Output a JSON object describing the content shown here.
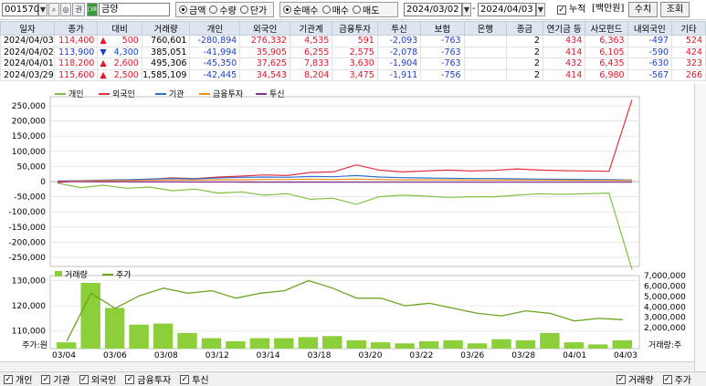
{
  "toolbar": {
    "code": "001570",
    "name": "금양",
    "amount_group": [
      "금액",
      "수량",
      "단가"
    ],
    "amount_selected": 0,
    "buy_group": [
      "순매수",
      "매수",
      "매도"
    ],
    "buy_selected": 0,
    "date_from": "2024/03/02",
    "date_to": "2024/04/03",
    "cumulative_label": "누적",
    "unit_label": "[백만원]",
    "btn_fix": "수치",
    "btn_query": "조회",
    "logo_text": "[38]"
  },
  "grid": {
    "headers": [
      "일자",
      "종가",
      "대비",
      "거래량",
      "개인",
      "외국인",
      "기관계",
      "금융투자",
      "투신",
      "보험",
      "은행",
      "종금",
      "연기금 등",
      "사모펀드",
      "내외국인",
      "기타"
    ],
    "rows": [
      [
        "2024/04/03",
        "114,400",
        "▲",
        "500",
        "760,601",
        "-280,894",
        "276,332",
        "4,535",
        "591",
        "-2,093",
        "-763",
        "",
        "2",
        "434",
        "6,363",
        "-497",
        "524"
      ],
      [
        "2024/04/02",
        "113,900",
        "▼",
        "4,300",
        "385,051",
        "-41,994",
        "35,905",
        "6,255",
        "2,575",
        "-2,078",
        "-763",
        "",
        "2",
        "414",
        "6,105",
        "-590",
        "424"
      ],
      [
        "2024/04/01",
        "118,200",
        "▲",
        "2,600",
        "495,306",
        "-45,350",
        "37,625",
        "7,833",
        "3,630",
        "-1,904",
        "-763",
        "",
        "2",
        "432",
        "6,435",
        "-630",
        "323"
      ],
      [
        "2024/03/29",
        "115,600",
        "▲",
        "2,500",
        "1,585,109",
        "-42,445",
        "34,543",
        "8,204",
        "3,475",
        "-1,911",
        "-756",
        "",
        "2",
        "414",
        "6,980",
        "-567",
        "266"
      ]
    ]
  },
  "chart_data": [
    {
      "type": "line",
      "legend": [
        "개인",
        "외국인",
        "기관",
        "금융투자",
        "투신"
      ],
      "colors": [
        "#7dc242",
        "#e1323f",
        "#2c6fcf",
        "#f18f1d",
        "#8a2f9c"
      ],
      "yticks": [
        "250,000",
        "200,000",
        "150,000",
        "100,000",
        "50,000",
        "0",
        "-50,000",
        "-100,000",
        "-150,000",
        "-200,000",
        "-250,000"
      ],
      "ylim": [
        -280000,
        280000
      ],
      "series": [
        {
          "name": "개인",
          "values": [
            -5000,
            -20000,
            -12000,
            -22000,
            -18000,
            -30000,
            -25000,
            -38000,
            -34000,
            -45000,
            -40000,
            -58000,
            -55000,
            -75000,
            -50000,
            -45000,
            -48000,
            -52000,
            -50000,
            -50000,
            -45000,
            -40000,
            -42000,
            -40000,
            -38000,
            -290000
          ]
        },
        {
          "name": "외국인",
          "values": [
            -3000,
            2000,
            0,
            5000,
            8000,
            12000,
            10000,
            15000,
            18000,
            22000,
            20000,
            30000,
            32000,
            55000,
            38000,
            32000,
            35000,
            38000,
            35000,
            37000,
            42000,
            38000,
            36000,
            35000,
            34000,
            270000
          ]
        },
        {
          "name": "기관",
          "values": [
            2000,
            3000,
            5000,
            6000,
            8000,
            10000,
            9000,
            12000,
            14000,
            15000,
            14000,
            17000,
            16000,
            20000,
            15000,
            13000,
            12000,
            11000,
            10000,
            10000,
            9000,
            8000,
            7500,
            7000,
            6500,
            5000
          ]
        },
        {
          "name": "금융투자",
          "values": [
            1000,
            2000,
            3000,
            3000,
            4000,
            5000,
            5000,
            6000,
            6000,
            7000,
            7000,
            8000,
            7000,
            8000,
            7000,
            6000,
            6000,
            6000,
            5000,
            5000,
            5000,
            5000,
            4500,
            4000,
            4000,
            3500
          ]
        },
        {
          "name": "투신",
          "values": [
            0,
            -500,
            -800,
            -1000,
            -1200,
            -1300,
            -1500,
            -1600,
            -1700,
            -1800,
            -1800,
            -1900,
            -1900,
            -2000,
            -2000,
            -2000,
            -2000,
            -2050,
            -2050,
            -2050,
            -2050,
            -2080,
            -2080,
            -2080,
            -2090,
            -2093
          ]
        }
      ]
    },
    {
      "type": "bar",
      "legend": [
        "거래량",
        "주가"
      ],
      "colors": [
        "#8ccf3b",
        "#6aa520"
      ],
      "yticks_left": [
        "130,000",
        "120,000",
        "110,000"
      ],
      "ylim_left": [
        103000,
        132000
      ],
      "yticks_right": [
        "7,000,000",
        "6,000,000",
        "5,000,000",
        "4,000,000",
        "3,000,000",
        "2,000,000"
      ],
      "ylim_right": [
        0,
        7000000
      ],
      "xticks": [
        "03/04",
        "03/06",
        "03/08",
        "03/12",
        "03/14",
        "03/18",
        "03/20",
        "03/22",
        "03/26",
        "03/28",
        "04/01",
        "04/03"
      ],
      "left_axis_label": "주가:원",
      "right_axis_label": "거래량:주",
      "volume": [
        600000,
        6300000,
        3900000,
        2300000,
        2400000,
        1500000,
        1000000,
        700000,
        1000000,
        1000000,
        1100000,
        1200000,
        800000,
        600000,
        500000,
        700000,
        800000,
        500000,
        900000,
        800000,
        1500000,
        600000,
        400000,
        800000
      ],
      "price": [
        106000,
        125000,
        119000,
        124000,
        127000,
        125000,
        126000,
        123000,
        125000,
        126000,
        130000,
        127000,
        123000,
        123000,
        120000,
        121000,
        119000,
        117000,
        116000,
        118000,
        117000,
        114000,
        115000,
        114500
      ]
    }
  ],
  "statusbar": {
    "items": [
      "개인",
      "기관",
      "외국인",
      "금융투자",
      "투신"
    ],
    "right_items": [
      "거래량",
      "주가"
    ]
  }
}
